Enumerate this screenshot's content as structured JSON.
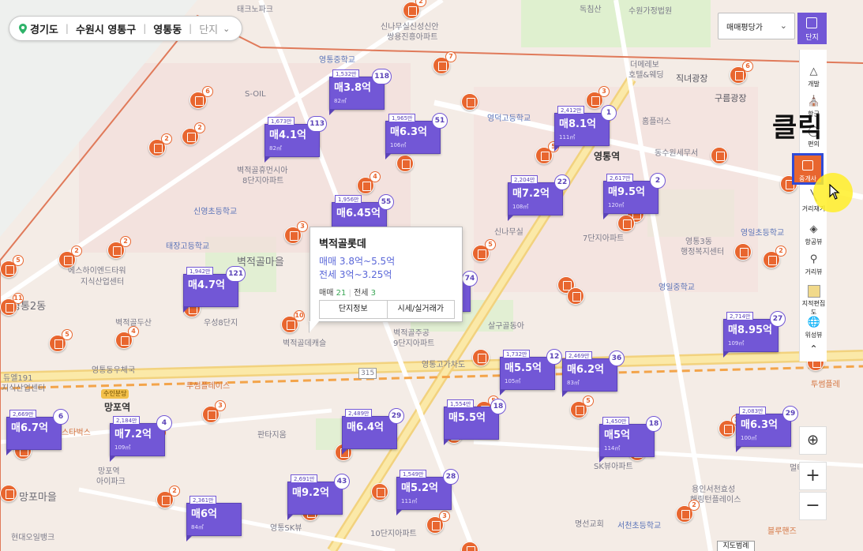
{
  "breadcrumb": {
    "province": "경기도",
    "city": "수원시 영통구",
    "dong": "영통동",
    "type": "단지"
  },
  "price_select": {
    "value": "매매평당가"
  },
  "danji_button": {
    "label": "단지"
  },
  "toolbar": [
    {
      "label": "개발",
      "icon": "development-icon"
    },
    {
      "label": "학군",
      "icon": "school-icon"
    },
    {
      "label": "편의",
      "icon": "convenience-icon"
    },
    {
      "label": "중개사",
      "icon": "realtor-icon"
    },
    {
      "label": "거리재기",
      "icon": "ruler-icon"
    },
    {
      "label": "항공뷰",
      "icon": "aerial-view-icon"
    },
    {
      "label": "거리뷰",
      "icon": "street-view-icon"
    },
    {
      "label": "지적편집도",
      "icon": "cadastral-map-icon"
    },
    {
      "label": "위성뷰",
      "icon": "satellite-view-icon"
    }
  ],
  "annotation": {
    "click_label": "클릭"
  },
  "zoom": {
    "in": "+",
    "out": "−"
  },
  "map_legend": {
    "label": "지도범례"
  },
  "popup": {
    "title": "벽적골롯데",
    "sale_range": "매매 3.8억~5.5억",
    "jeonse_range": "전세 3억~3.25억",
    "sale_label": "매매",
    "sale_count": "21",
    "jeonse_label": "전세",
    "jeonse_count": "3",
    "btn_info": "단지정보",
    "btn_price": "시세/실거래가"
  },
  "price_markers": [
    {
      "ppy": "1,532만",
      "count": "118",
      "price": "매3.8억",
      "area": "82㎡"
    },
    {
      "ppy": "1,673만",
      "count": "113",
      "price": "매4.1억",
      "area": "82㎡"
    },
    {
      "ppy": "1,965만",
      "count": "51",
      "price": "매6.3억",
      "area": "106㎡"
    },
    {
      "ppy": "2,412만",
      "count": "1",
      "price": "매8.1억",
      "area": "111㎡"
    },
    {
      "ppy": "1,956만",
      "count": "55",
      "price": "매6.45억",
      "area": ""
    },
    {
      "ppy": "2,204만",
      "count": "22",
      "price": "매7.2억",
      "area": "108㎡"
    },
    {
      "ppy": "2,617만",
      "count": "2",
      "price": "매9.5억",
      "area": "120㎡"
    },
    {
      "ppy": "1,942만",
      "count": "121",
      "price": "매4.7억",
      "area": ""
    },
    {
      "ppy": "2,714만",
      "count": "27",
      "price": "매8.95억",
      "area": "109㎡"
    },
    {
      "ppy": "1,732만",
      "count": "12",
      "price": "매5.5억",
      "area": "105㎡"
    },
    {
      "ppy": "2,469만",
      "count": "36",
      "price": "매6.2억",
      "area": "83㎡"
    },
    {
      "ppy": "2,669만",
      "count": "6",
      "price": "매6.7억",
      "area": ""
    },
    {
      "ppy": "2,184만",
      "count": "4",
      "price": "매7.2억",
      "area": "109㎡"
    },
    {
      "ppy": "2,489만",
      "count": "29",
      "price": "매6.4억",
      "area": ""
    },
    {
      "ppy": "1,554만",
      "count": "18",
      "price": "매5.5억",
      "area": ""
    },
    {
      "ppy": "1,450만",
      "count": "18",
      "price": "매5억",
      "area": "114㎡"
    },
    {
      "ppy": "2,083만",
      "count": "29",
      "price": "매6.3억",
      "area": "100㎡"
    },
    {
      "ppy": "2,691만",
      "count": "43",
      "price": "매9.2억",
      "area": ""
    },
    {
      "ppy": "1,549만",
      "count": "28",
      "price": "매5.2억",
      "area": "111㎡"
    },
    {
      "ppy": "2,361만",
      "count": "",
      "price": "매6억",
      "area": "84㎡"
    },
    {
      "ppy": "",
      "count": "74",
      "price": "",
      "area": ""
    }
  ],
  "map_labels": {
    "l1": "태크노파크",
    "l2": "독침산",
    "l3": "수원가정법원",
    "l4": "신나무실신성신안",
    "l5": "쌍용진흥아파트",
    "l6": "영통중학교",
    "l7": "S-OIL",
    "l8": "더메레보",
    "l9": "호텔&웨딩",
    "l10": "직녀광장",
    "l11": "구름광장",
    "l12": "영덕고등학교",
    "l13": "홈플러스",
    "l14": "동수원세무서",
    "l15": "벽적골휴먼시아",
    "l16": "8단지아파트",
    "l17": "영통역",
    "l18": "신영초등학교",
    "l19": "태장고등학교",
    "l20": "벽적골마을",
    "l21": "에스하이엔드타워",
    "l22": "지식산업센터",
    "l23": "영통2동",
    "l24": "영일초등학교",
    "l25": "영통3동",
    "l26": "행정복지센터",
    "l27": "영일중학교",
    "l28": "신나무실",
    "l29": "7단지아파트",
    "l30": "우성8단지",
    "l31": "벽적골두산",
    "l32": "벽적골데캐슬",
    "l33": "9단지아파트",
    "l34": "벽적골주공",
    "l35": "살구골동아",
    "l36": "영통동우체국",
    "l37": "영통고가차도",
    "l38": "듀엘191",
    "l39": "지식산업센터",
    "l40": "투썸플레이스",
    "l41": "망포역",
    "l42": "수인분당",
    "l43": "스타벅스",
    "l44": "판타지움",
    "l45": "망포역",
    "l46": "아이파크",
    "l47": "망포마을",
    "l48": "해링턴플레이스",
    "l49": "서천초등학교",
    "l50": "용인서천효성",
    "l51": "명선교회",
    "l52": "현대오일뱅크",
    "l53": "영통SK뷰",
    "l54": "10단지아파트",
    "l55": "멀티미디",
    "l56": "블루핸즈",
    "l57": "315",
    "l58": "SK뷰아파트",
    "l59": "투썸플레"
  }
}
